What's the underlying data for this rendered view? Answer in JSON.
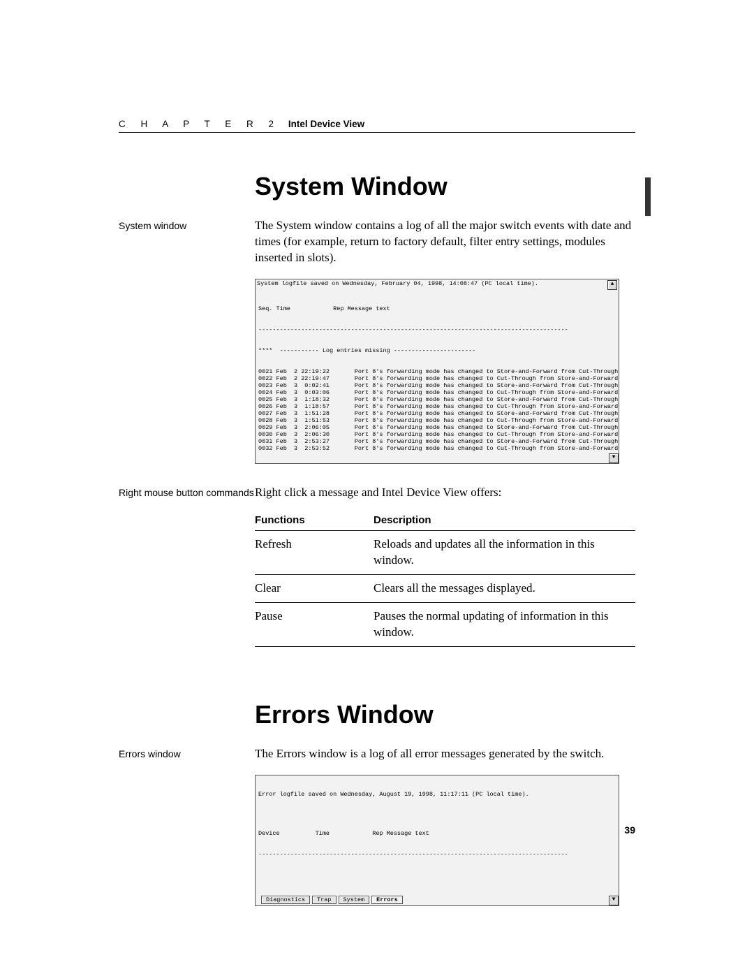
{
  "header": {
    "chapter_word": "C H A P T E R 2",
    "chapter_title": "Intel Device View"
  },
  "page_number": "39",
  "sections": {
    "system": {
      "heading": "System Window",
      "side_label": "System window",
      "paragraph": "The System window contains a log of all the major switch events with date and times (for example, return to factory default, filter entry settings, modules inserted in slots).",
      "screenshot": {
        "title": "System logfile saved on Wednesday, February 04, 1998, 14:08:47  (PC local time).",
        "scroll_up": "▲",
        "scroll_down": "▼",
        "columns_line": "Seq. Time            Rep Message text",
        "columns_rule": "---------------------------------------------------------------------------------------",
        "missing_line": "****  ----------- Log entries missing -----------------------",
        "rows": [
          {
            "seq": "0021",
            "date": "Feb  2",
            "time": "22:19:22",
            "msg": "Port 8's forwarding mode has changed to Store-and-Forward from Cut-Through"
          },
          {
            "seq": "0022",
            "date": "Feb  2",
            "time": "22:19:47",
            "msg": "Port 8's forwarding mode has changed to Cut-Through from Store-and-Forward"
          },
          {
            "seq": "0023",
            "date": "Feb  3",
            "time": " 0:02:41",
            "msg": "Port 8's forwarding mode has changed to Store-and-Forward from Cut-Through"
          },
          {
            "seq": "0024",
            "date": "Feb  3",
            "time": " 0:03:06",
            "msg": "Port 8's forwarding mode has changed to Cut-Through from Store-and-Forward"
          },
          {
            "seq": "0025",
            "date": "Feb  3",
            "time": " 1:18:32",
            "msg": "Port 8's forwarding mode has changed to Store-and-Forward from Cut-Through"
          },
          {
            "seq": "0026",
            "date": "Feb  3",
            "time": " 1:18:57",
            "msg": "Port 8's forwarding mode has changed to Cut-Through from Store-and-Forward"
          },
          {
            "seq": "0027",
            "date": "Feb  3",
            "time": " 1:51:28",
            "msg": "Port 8's forwarding mode has changed to Store-and-Forward from Cut-Through"
          },
          {
            "seq": "0028",
            "date": "Feb  3",
            "time": " 1:51:53",
            "msg": "Port 8's forwarding mode has changed to Cut-Through from Store-and-Forward"
          },
          {
            "seq": "0029",
            "date": "Feb  3",
            "time": " 2:06:05",
            "msg": "Port 8's forwarding mode has changed to Store-and-Forward from Cut-Through"
          },
          {
            "seq": "0030",
            "date": "Feb  3",
            "time": " 2:06:30",
            "msg": "Port 8's forwarding mode has changed to Cut-Through from Store-and-Forward"
          },
          {
            "seq": "0031",
            "date": "Feb  3",
            "time": " 2:53:27",
            "msg": "Port 8's forwarding mode has changed to Store-and-Forward from Cut-Through"
          },
          {
            "seq": "0032",
            "date": "Feb  3",
            "time": " 2:53:52",
            "msg": "Port 8's forwarding mode has changed to Cut-Through from Store-and-Forward"
          }
        ]
      },
      "rclick": {
        "side_label": "Right mouse button commands",
        "intro": "Right click a message and Intel Device View offers:",
        "table": {
          "head_func": "Functions",
          "head_desc": "Description",
          "rows": [
            {
              "func": "Refresh",
              "desc": "Reloads and updates all the information in this window."
            },
            {
              "func": "Clear",
              "desc": "Clears all the messages displayed."
            },
            {
              "func": "Pause",
              "desc": "Pauses the normal updating of information in this window."
            }
          ]
        }
      }
    },
    "errors": {
      "heading": "Errors Window",
      "side_label": "Errors window",
      "paragraph": "The Errors window is a log of all error messages generated by the switch.",
      "screenshot": {
        "title": "Error logfile saved on Wednesday, August 19, 1998, 11:17:11 (PC local time).",
        "columns_line": "Device          Time            Rep Message text",
        "columns_rule": "---------------------------------------------------------------------------------------",
        "tabs": [
          "Diagnostics",
          "Trap",
          "System",
          "Errors"
        ],
        "active_tab": 3,
        "scroll_down": "▼"
      }
    }
  }
}
